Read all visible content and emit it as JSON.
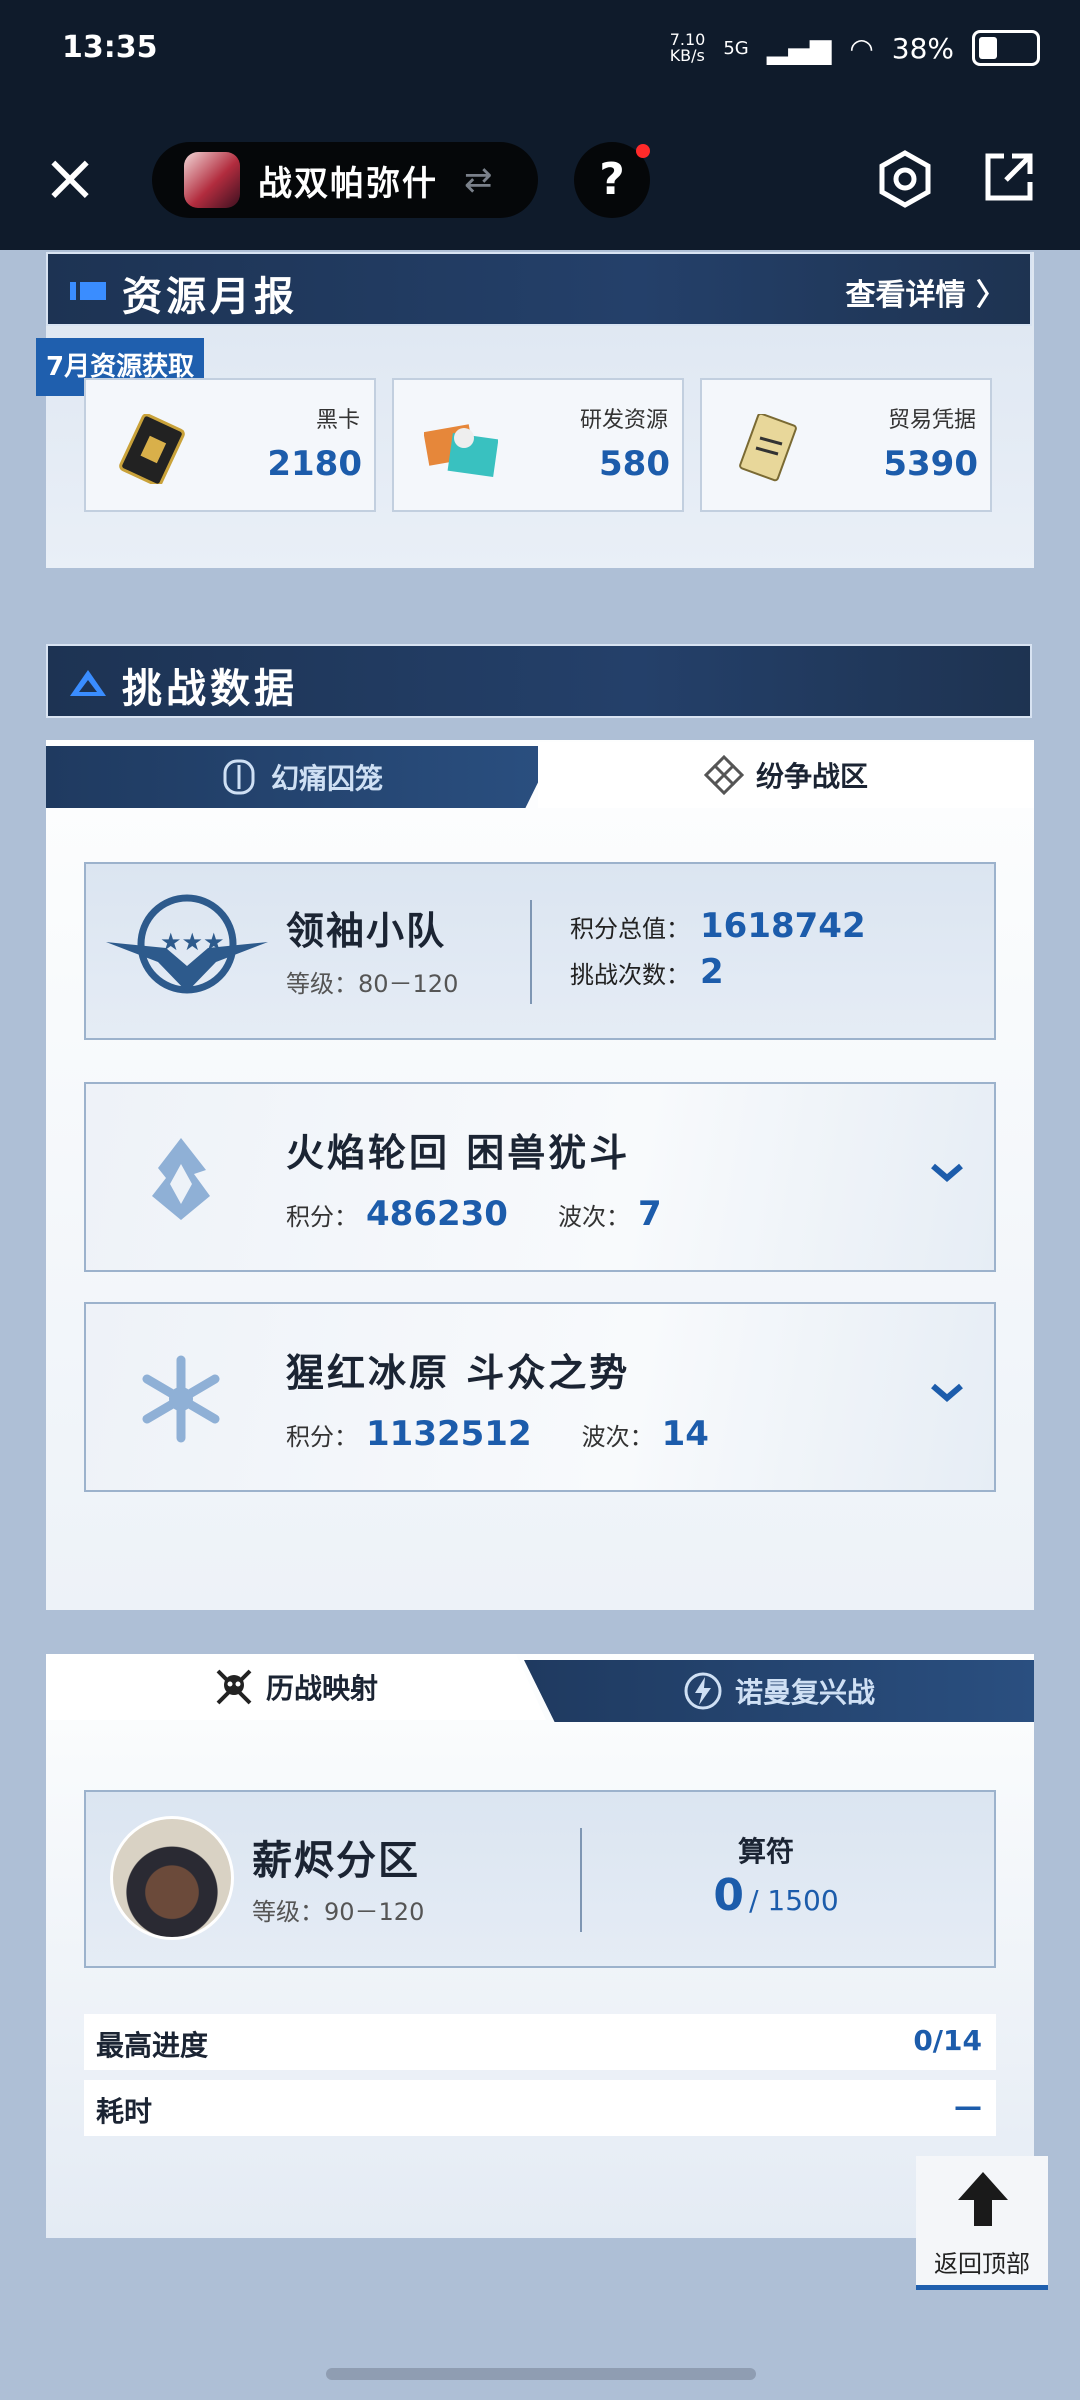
{
  "status_bar": {
    "time": "13:35",
    "net_speed": "7.10\nKB/s",
    "network": "5G",
    "battery": "38%"
  },
  "app_header": {
    "game_name": "战双帕弥什",
    "swap_icon": "swap-icon",
    "help_label": "?",
    "colors": {
      "bar": "#0f1b2b"
    }
  },
  "resource_report": {
    "title": "资源月报",
    "detail_link": "查看详情 〉",
    "month_tag": "7月资源获取",
    "items": [
      {
        "label": "黑卡",
        "value": "2180",
        "icon": "black-card-icon"
      },
      {
        "label": "研发资源",
        "value": "580",
        "icon": "research-resource-icon"
      },
      {
        "label": "贸易凭据",
        "value": "5390",
        "icon": "trade-voucher-icon"
      }
    ]
  },
  "challenge": {
    "title": "挑战数据",
    "tabs": [
      {
        "label": "幻痛囚笼",
        "active": false
      },
      {
        "label": "纷争战区",
        "active": true
      }
    ],
    "leader": {
      "name": "领袖小队",
      "level": "等级：80－120",
      "total_label": "积分总值：",
      "total_value": "1618742",
      "count_label": "挑战次数：",
      "count_value": "2"
    },
    "bosses": [
      {
        "name": "火焰轮回 困兽犹斗",
        "score_label": "积分：",
        "score": "486230",
        "wave_label": "波次：",
        "wave": "7",
        "icon": "flame-icon"
      },
      {
        "name": "猩红冰原 斗众之势",
        "score_label": "积分：",
        "score": "1132512",
        "wave_label": "波次：",
        "wave": "14",
        "icon": "snowflake-icon"
      }
    ]
  },
  "history": {
    "tabs": [
      {
        "label": "历战映射",
        "active": true
      },
      {
        "label": "诺曼复兴战",
        "active": false
      }
    ],
    "zone": {
      "name": "薪烬分区",
      "level": "等级：90－120",
      "sigil_label": "算符",
      "sigil_current": "0",
      "sigil_max": "/ 1500"
    },
    "rows": [
      {
        "label": "最高进度",
        "value": "0/14"
      },
      {
        "label": "耗时",
        "value": "—"
      }
    ]
  },
  "back_to_top": "返回顶部",
  "accent_color": "#1c5cab"
}
